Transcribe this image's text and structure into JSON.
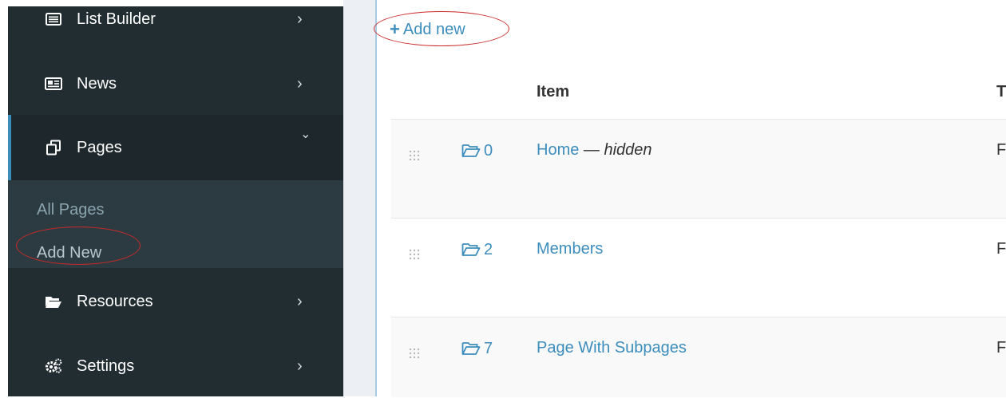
{
  "sidebar": {
    "items": [
      {
        "label": "List Builder",
        "icon": "list-icon"
      },
      {
        "label": "News",
        "icon": "newspaper-icon"
      },
      {
        "label": "Pages",
        "icon": "copy-icon"
      },
      {
        "label": "Resources",
        "icon": "folder-open-icon"
      },
      {
        "label": "Settings",
        "icon": "cogs-icon"
      }
    ],
    "submenu": [
      "All Pages",
      "Add New"
    ]
  },
  "main": {
    "add_new_label": "Add new",
    "table_header": {
      "item": "Item",
      "next_col_partial": "T"
    },
    "rows": [
      {
        "count": "0",
        "title": "Home",
        "separator": "—",
        "status": "hidden",
        "next_col_partial": "F"
      },
      {
        "count": "2",
        "title": "Members",
        "next_col_partial": "F"
      },
      {
        "count": "7",
        "title": "Page With Subpages",
        "next_col_partial": "F"
      }
    ]
  },
  "colors": {
    "sidebar_bg": "#222d32",
    "accent": "#3c8dbc",
    "annotation": "#cc2a2a"
  }
}
